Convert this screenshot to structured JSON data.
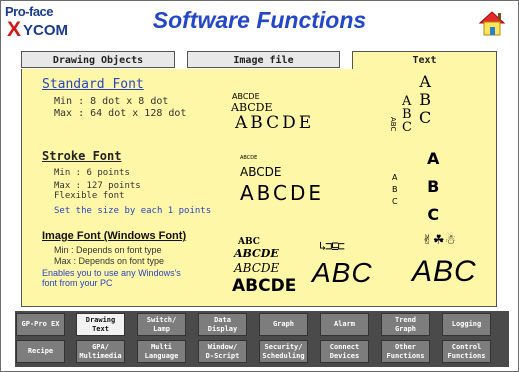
{
  "header": {
    "logo_top": "Pro-face",
    "logo_x": "X",
    "logo_com": "YCOM",
    "title": "Software Functions",
    "home_icon": "home-icon"
  },
  "tabs": [
    {
      "label": "Drawing Objects",
      "active": false
    },
    {
      "label": "Image file",
      "active": false
    },
    {
      "label": "Text",
      "active": true
    }
  ],
  "standard_font": {
    "title": "Standard Font",
    "min": "Min : 8 dot x 8 dot",
    "max": "Max : 64 dot x 128 dot",
    "sample_small_1": "ABCDE",
    "sample_small_2": "ABCDE",
    "sample_large": "ABCDE",
    "vertical_small": "ABC",
    "vertical_large": [
      "A",
      "B",
      "C"
    ]
  },
  "stroke_font": {
    "title": "Stroke Font",
    "min": "Min : 6 points",
    "max": "Max : 127 points",
    "flexible": "Flexible font",
    "set_size": "Set the size by each 1 points",
    "sample_tiny": "ABCDE",
    "sample_medium": "ABCDE",
    "sample_large": "ABCDE",
    "vertical_small": [
      "A",
      "B",
      "C"
    ],
    "vertical_large": [
      "A",
      "B",
      "C"
    ]
  },
  "image_font": {
    "title": "Image Font (Windows Font)",
    "min": "Min : Depends on font type",
    "max": "Max : Depends on font type",
    "enable_1": "Enables you to use any Windows's",
    "enable_2": "font from your PC",
    "samples": [
      "ABC",
      "ABCDE",
      "ABCDE",
      "ABCDE"
    ],
    "sample_abc_1": "ABC",
    "sample_abc_2": "ABC"
  },
  "bottom_buttons": {
    "row1": [
      "GP-Pro EX",
      "Drawing\nText",
      "Switch/\nLamp",
      "Data\nDisplay",
      "Graph",
      "Alarm",
      "Trend\nGraph",
      "Logging"
    ],
    "row2": [
      "Recipe",
      "GPA/\nMultimedia",
      "Multi\nLanguage",
      "Window/\nD-Script",
      "Security/\nScheduling",
      "Connect\nDevices",
      "Other\nFunctions",
      "Control\nFunctions"
    ],
    "active": "Drawing\nText"
  }
}
